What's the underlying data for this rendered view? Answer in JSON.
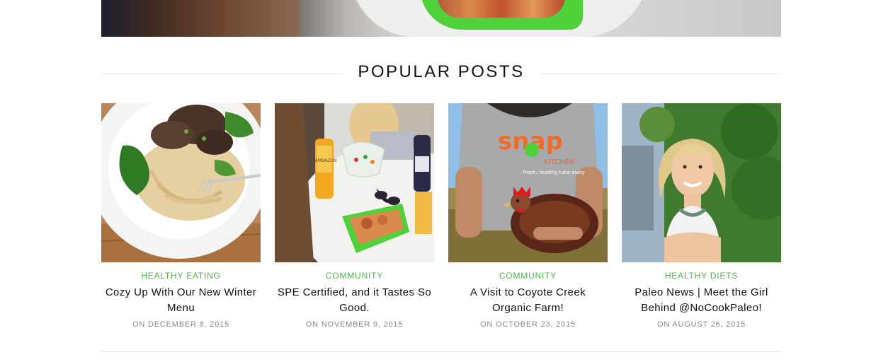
{
  "section": {
    "title": "POPULAR POSTS"
  },
  "posts": [
    {
      "category": "HEALTHY EATING",
      "title": "Cozy Up With Our New Winter Menu",
      "date": "ON DECEMBER 8, 2015"
    },
    {
      "category": "COMMUNITY",
      "title": "SPE Certified, and it Tastes So Good.",
      "date": "ON NOVEMBER 9, 2015"
    },
    {
      "category": "COMMUNITY",
      "title": "A Visit to Coyote Creek Organic Farm!",
      "date": "ON OCTOBER 23, 2015"
    },
    {
      "category": "HEALTHY DIETS",
      "title": "Paleo News | Meet the Girl Behind @NoCookPaleo!",
      "date": "ON AUGUST 26, 2015"
    }
  ],
  "thumb_art": {
    "post2_bottle_text": "SAMBAZON",
    "post3_shirt_brand": "snap",
    "post3_shirt_sub": "KITCHEN",
    "post3_shirt_tagline": "Fresh, healthy take-away"
  },
  "colors": {
    "accent": "#4cb848",
    "title": "#111111",
    "meta": "#8a8a8a",
    "rule": "#e3e3e3"
  }
}
